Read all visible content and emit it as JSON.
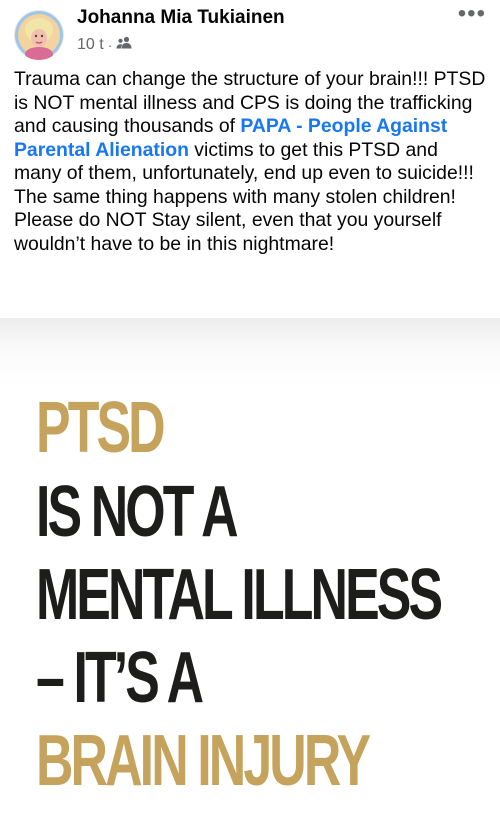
{
  "post": {
    "author": "Johanna Mia Tukiainen",
    "timestamp": "10 t",
    "separator": "·",
    "audience_icon": "friends-icon",
    "more_label": "•••",
    "text_before_link": "Trauma can change the structure of your brain!!! PTSD is NOT mental illness and CPS is doing the trafficking and causing thousands of ",
    "link_text": "PAPA - People Against Parental Alienation",
    "text_after_link": " victims to get this PTSD and many of them, unfortunately, end up even to suicide!!! The same thing happens with many stolen children! Please do NOT Stay silent, even that you yourself wouldn’t have to be in this nightmare!"
  },
  "image": {
    "lines": [
      "PTSD",
      "IS NOT A",
      "MENTAL ILLNESS",
      "– IT’S A",
      "BRAIN INJURY"
    ],
    "colors": {
      "accent": "#c5a35c",
      "dark": "#1d1d1b"
    }
  },
  "colors": {
    "link": "#1877f2",
    "meta": "#65676b"
  }
}
